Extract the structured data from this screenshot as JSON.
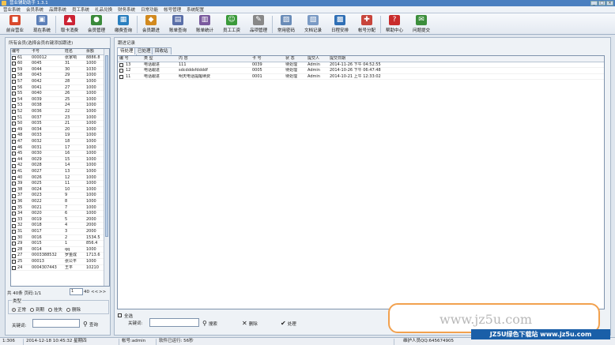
{
  "window": {
    "title": "营业辅助助手 1.3.1"
  },
  "menu": [
    "营业系统",
    "会员系统",
    "品牌系统",
    "员工系统",
    "礼品兑换",
    "财务系统",
    "日常功能",
    "帐号管理",
    "系统配置"
  ],
  "toolbar": [
    {
      "label": "前台营业",
      "icon": "register-icon",
      "color": "#d9482b",
      "glyph": "■"
    },
    {
      "label": "现在系统",
      "icon": "system-icon",
      "color": "#5c7fb8",
      "glyph": "▣"
    },
    {
      "label": "取卡消费",
      "icon": "card-icon",
      "color": "#c23",
      "glyph": "▲"
    },
    {
      "label": "会员管理",
      "icon": "members-icon",
      "color": "#3a8a3a",
      "glyph": "●"
    },
    {
      "label": "缴费查询",
      "icon": "payment-icon",
      "color": "#2a7fbf",
      "glyph": "▦"
    },
    {
      "label": "会员跟进",
      "icon": "followup-icon",
      "color": "#d28a1f",
      "glyph": "◆"
    },
    {
      "label": "账单查询",
      "icon": "bill-icon",
      "color": "#5a6fa8",
      "glyph": "▤"
    },
    {
      "label": "账单统计",
      "icon": "stats-icon",
      "color": "#7a5a9e",
      "glyph": "▥"
    },
    {
      "label": "员工工资",
      "icon": "salary-icon",
      "color": "#3a9a3a",
      "glyph": "☺"
    },
    {
      "label": "品项管理",
      "icon": "items-icon",
      "color": "#888",
      "glyph": "✎"
    },
    {
      "label": "常用密码",
      "icon": "password-icon",
      "color": "#6a8cb8",
      "glyph": "▨"
    },
    {
      "label": "文档记录",
      "icon": "document-icon",
      "color": "#7a9ac4",
      "glyph": "▧"
    },
    {
      "label": "日程安排",
      "icon": "schedule-icon",
      "color": "#2f6fb5",
      "glyph": "▩"
    },
    {
      "label": "帐号分配",
      "icon": "account-icon",
      "color": "#c8453b",
      "glyph": "✚"
    },
    {
      "label": "帮助中心",
      "icon": "help-icon",
      "color": "#c92b2b",
      "glyph": "?"
    },
    {
      "label": "问题提交",
      "icon": "feedback-icon",
      "color": "#3c8e3c",
      "glyph": "✉"
    }
  ],
  "left": {
    "title": "所有会员(选择会员右键添加跟进)",
    "columns": [
      "编号",
      "卡号",
      "姓名",
      "余额"
    ],
    "rows": [
      [
        "61",
        "000012",
        "张家响",
        "8886.8"
      ],
      [
        "60",
        "0045",
        "31",
        "1000"
      ],
      [
        "59",
        "0044",
        "30",
        "1030"
      ],
      [
        "58",
        "0043",
        "29",
        "1000"
      ],
      [
        "57",
        "0042",
        "28",
        "1000"
      ],
      [
        "56",
        "0041",
        "27",
        "1000"
      ],
      [
        "55",
        "0040",
        "26",
        "1000"
      ],
      [
        "54",
        "0039",
        "25",
        "1000"
      ],
      [
        "53",
        "0038",
        "24",
        "1000"
      ],
      [
        "52",
        "0036",
        "22",
        "1000"
      ],
      [
        "51",
        "0037",
        "23",
        "1000"
      ],
      [
        "50",
        "0035",
        "21",
        "1000"
      ],
      [
        "49",
        "0034",
        "20",
        "1000"
      ],
      [
        "48",
        "0033",
        "19",
        "1000"
      ],
      [
        "47",
        "0032",
        "18",
        "1000"
      ],
      [
        "46",
        "0031",
        "17",
        "1000"
      ],
      [
        "45",
        "0030",
        "16",
        "1000"
      ],
      [
        "44",
        "0029",
        "15",
        "1000"
      ],
      [
        "42",
        "0028",
        "14",
        "1000"
      ],
      [
        "41",
        "0027",
        "13",
        "1000"
      ],
      [
        "40",
        "0026",
        "12",
        "1000"
      ],
      [
        "39",
        "0025",
        "11",
        "1000"
      ],
      [
        "38",
        "0024",
        "10",
        "1000"
      ],
      [
        "37",
        "0023",
        "9",
        "1000"
      ],
      [
        "36",
        "0022",
        "8",
        "1000"
      ],
      [
        "35",
        "0021",
        "7",
        "1000"
      ],
      [
        "34",
        "0020",
        "6",
        "1000"
      ],
      [
        "33",
        "0019",
        "5",
        "2000"
      ],
      [
        "32",
        "0018",
        "4",
        "2000"
      ],
      [
        "31",
        "0017",
        "3",
        "2000"
      ],
      [
        "30",
        "0016",
        "2",
        "1534.5"
      ],
      [
        "29",
        "0015",
        "1",
        "856.4"
      ],
      [
        "28",
        "0014",
        "qq",
        "1000"
      ],
      [
        "27",
        "0003388532",
        "罗金成",
        "1713.6"
      ],
      [
        "25",
        "00013",
        "张公平",
        "1000"
      ],
      [
        "24",
        "0004307443",
        "王平",
        "10210"
      ]
    ],
    "pager": {
      "summary": "共 40条 页码:1/1",
      "page": "1",
      "page_size": "40",
      "prev": "<<",
      "next": ">>"
    },
    "type_label": "类型",
    "types": [
      "正常",
      "到期",
      "挂失",
      "删除"
    ],
    "keyword_label": "关键词:",
    "search": "查询"
  },
  "right": {
    "title": "跟进记录",
    "tabs": [
      "待处理",
      "已处理",
      "回收站"
    ],
    "columns": [
      "编 号",
      "类 型",
      "内 容",
      "卡 号",
      "状 态",
      "提交人",
      "提交日期"
    ],
    "rows": [
      [
        "13",
        "电话跟进",
        "111",
        "0039",
        "待处理",
        "Admin",
        "2014-11-26 下午 04:52:55"
      ],
      [
        "12",
        "电话跟进",
        "sdcdddsfddddf",
        "0005",
        "待处理",
        "Admin",
        "2014-10-26 下午 06:47:48"
      ],
      [
        "11",
        "电话跟进",
        "明天电话提醒续费",
        "0001",
        "待处理",
        "Admin",
        "2014-10-21 上午 12:33:02"
      ]
    ],
    "select_all": "全选",
    "keyword_label": "关键词:",
    "search": "搜索",
    "delete": "删除",
    "process": "处理"
  },
  "status": {
    "count": "1:306",
    "datetime": "2014-12-18 10:45:32 星期四",
    "account": "帐号:admin",
    "uptime": "软件已运行: 56秒",
    "maintainer": "维护人员QQ:645674905"
  },
  "watermark": {
    "url": "www.jz5u.com",
    "bar": "JZ5U绿色下载站 www.jz5u.com"
  }
}
